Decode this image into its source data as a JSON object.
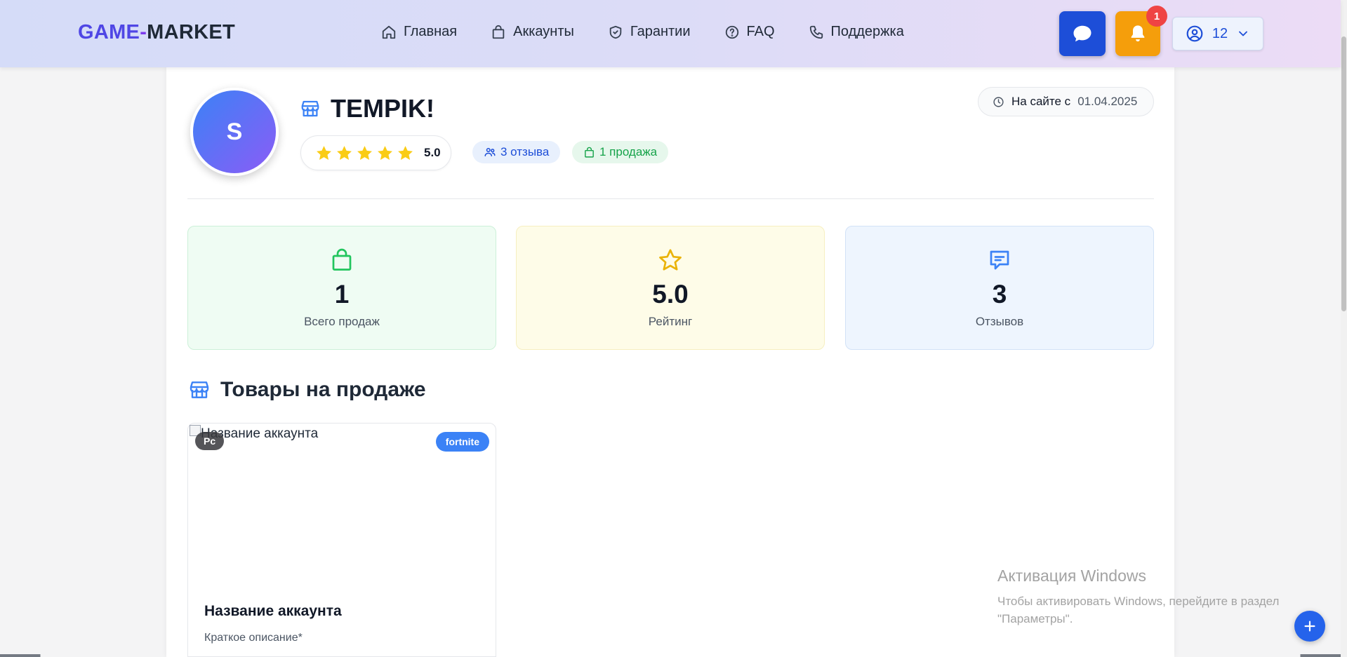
{
  "header": {
    "logo": {
      "part1": "GAME",
      "part2": "-",
      "part3": "MARKET"
    },
    "nav": [
      {
        "label": "Главная",
        "icon": "home-icon"
      },
      {
        "label": "Аккаунты",
        "icon": "shopping-bag-icon"
      },
      {
        "label": "Гарантии",
        "icon": "shield-check-icon"
      },
      {
        "label": "FAQ",
        "icon": "help-circle-icon"
      },
      {
        "label": "Поддержка",
        "icon": "phone-icon"
      }
    ],
    "notifications_count": "1",
    "user_label": "12"
  },
  "seller": {
    "avatar_letter": "S",
    "name": "TEMPIK!",
    "rating": "5.0",
    "stars": 5,
    "reviews_chip": "3 отзыва",
    "sales_chip": "1 продажа",
    "since_label": "На сайте с",
    "since_date": "01.04.2025"
  },
  "stats": [
    {
      "value": "1",
      "label": "Всего продаж",
      "icon": "shopping-bag-icon",
      "color": "#22c55e"
    },
    {
      "value": "5.0",
      "label": "Рейтинг",
      "icon": "star-icon",
      "color": "#eab308"
    },
    {
      "value": "3",
      "label": "Отзывов",
      "icon": "message-icon",
      "color": "#3b82f6"
    }
  ],
  "section": {
    "title": "Товары на продаже"
  },
  "products": [
    {
      "image_alt": "Название аккаунта",
      "platform": "Pc",
      "game": "fortnite",
      "name": "Название аккаунта",
      "description": "Краткое описание*"
    }
  ],
  "windows_watermark": {
    "title": "Активация Windows",
    "subtitle": "Чтобы активировать Windows, перейдите в раздел \"Параметры\"."
  },
  "colors": {
    "accent": "#1d4ed8",
    "bell": "#f59e0b",
    "badge": "#ef4444"
  }
}
